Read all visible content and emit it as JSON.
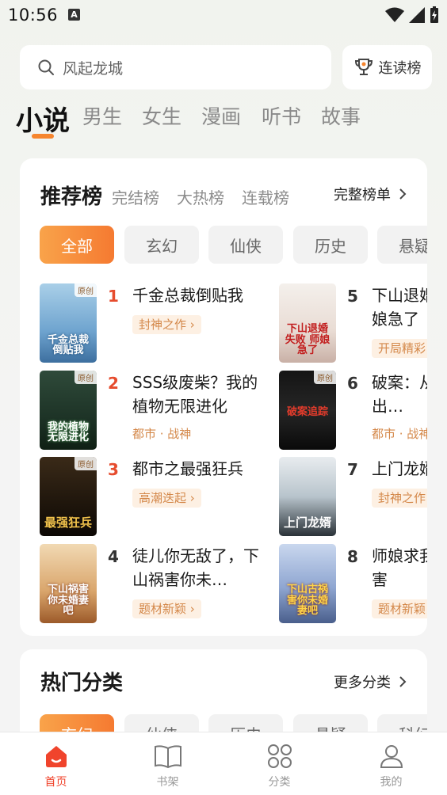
{
  "status": {
    "time": "10:56",
    "notif_glyph": "A"
  },
  "search": {
    "placeholder": "风起龙城"
  },
  "rank_button": {
    "label": "连读榜"
  },
  "tabs": [
    {
      "label": "小说",
      "active": true
    },
    {
      "label": "男生"
    },
    {
      "label": "女生"
    },
    {
      "label": "漫画"
    },
    {
      "label": "听书"
    },
    {
      "label": "故事"
    }
  ],
  "recommend": {
    "title": "推荐榜",
    "sub_tabs": [
      "完结榜",
      "大热榜",
      "连载榜"
    ],
    "full_list": "完整榜单",
    "chips": [
      "全部",
      "玄幻",
      "仙侠",
      "历史",
      "悬疑"
    ],
    "books": [
      {
        "rank": "1",
        "title": "千金总裁倒贴我",
        "tag": "封神之作",
        "cover_text": "千金总裁倒贴我",
        "badge": "原创"
      },
      {
        "rank": "2",
        "title": "SSS级废柴？我的植物无限进化",
        "tag": "都市 · 战神",
        "cover_text": "我的植物无限进化",
        "badge": "原创"
      },
      {
        "rank": "3",
        "title": "都市之最强狂兵",
        "tag": "高潮迭起",
        "cover_text": "最强狂兵",
        "badge": "原创"
      },
      {
        "rank": "4",
        "title": "徒儿你无敌了，下山祸害你未…",
        "tag": "题材新颖",
        "cover_text": "下山祸害你未婚妻吧",
        "badge": ""
      },
      {
        "rank": "5",
        "title": "下山退婚失败，师娘急了",
        "tag": "开局精彩",
        "cover_text": "下山退婚失败 师娘急了",
        "badge": ""
      },
      {
        "rank": "6",
        "title": "破案：从市井捞出…",
        "tag": "都市 · 战神",
        "cover_text": "破案追踪",
        "badge": "原创"
      },
      {
        "rank": "7",
        "title": "上门龙婿",
        "tag": "封神之作",
        "cover_text": "上门龙婿",
        "badge": ""
      },
      {
        "rank": "8",
        "title": "师娘求我下山去祸害",
        "tag": "题材新颖",
        "cover_text": "下山古祸害你未婚妻吧",
        "badge": ""
      }
    ]
  },
  "hot_categories": {
    "title": "热门分类",
    "more": "更多分类",
    "chips": [
      "玄幻",
      "仙侠",
      "历史",
      "悬疑",
      "科幻"
    ]
  },
  "bottom_nav": [
    {
      "label": "首页",
      "icon": "home-icon",
      "active": true
    },
    {
      "label": "书架",
      "icon": "book-icon"
    },
    {
      "label": "分类",
      "icon": "category-icon"
    },
    {
      "label": "我的",
      "icon": "profile-icon"
    }
  ],
  "colors": {
    "accent": "#f6852e",
    "active_nav": "#f0442c",
    "rank_top": "#e64c2e",
    "tag_bg": "#fdf0e3",
    "tag_fg": "#d4884a"
  }
}
